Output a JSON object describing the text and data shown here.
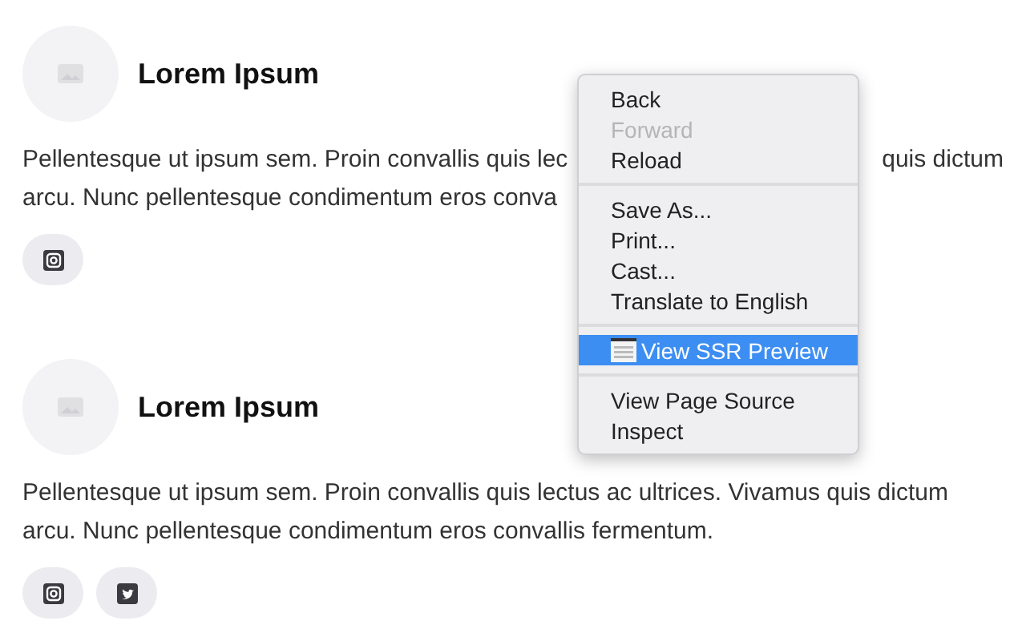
{
  "cards": [
    {
      "title": "Lorem Ipsum",
      "lines": [
        {
          "left": "Pellentesque ut ipsum sem. Proin convallis quis lec",
          "right": "quis dictum"
        },
        {
          "left": "arcu. Nunc pellentesque condimentum eros conva"
        }
      ],
      "socials": [
        {
          "kind": "instagram"
        }
      ]
    },
    {
      "title": "Lorem Ipsum",
      "lines": [
        {
          "left": "Pellentesque ut ipsum sem. Proin convallis quis lectus ac ultrices. Vivamus quis dictum"
        },
        {
          "left": "arcu. Nunc pellentesque condimentum eros convallis fermentum."
        }
      ],
      "socials": [
        {
          "kind": "instagram"
        },
        {
          "kind": "twitter"
        }
      ]
    }
  ],
  "context_menu": {
    "groups": [
      [
        {
          "label": "Back",
          "disabled": false,
          "selected": false
        },
        {
          "label": "Forward",
          "disabled": true,
          "selected": false
        },
        {
          "label": "Reload",
          "disabled": false,
          "selected": false
        }
      ],
      [
        {
          "label": "Save As...",
          "disabled": false,
          "selected": false
        },
        {
          "label": "Print...",
          "disabled": false,
          "selected": false
        },
        {
          "label": "Cast...",
          "disabled": false,
          "selected": false
        },
        {
          "label": "Translate to English",
          "disabled": false,
          "selected": false
        }
      ],
      [
        {
          "label": "View SSR Preview",
          "disabled": false,
          "selected": true,
          "has_icon": true
        }
      ],
      [
        {
          "label": "View Page Source",
          "disabled": false,
          "selected": false
        },
        {
          "label": "Inspect",
          "disabled": false,
          "selected": false
        }
      ]
    ]
  }
}
